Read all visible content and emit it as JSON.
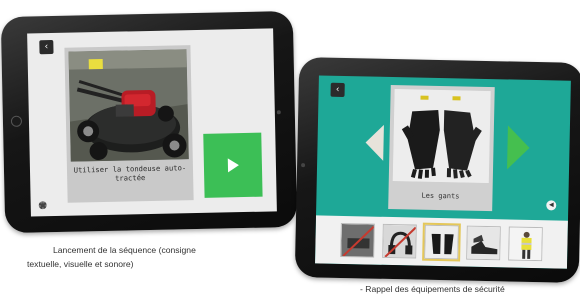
{
  "slide_left": {
    "back_icon": "chevron-left-icon",
    "card_caption": "Utiliser la tondeuse auto-tractée",
    "play_icon": "play-icon",
    "settings_icon": "gear-icon",
    "description_line1": "Lancement de la séquence (consigne",
    "description_line2": "textuelle, visuelle et sonore)"
  },
  "slide_right": {
    "back_icon": "chevron-left-icon",
    "card_caption": "Les gants",
    "prev_icon": "arrow-left-icon",
    "next_icon": "arrow-right-icon",
    "speaker_icon": "speaker-icon",
    "thumbnails": [
      {
        "name": "crossed-out-item-thumbnail",
        "active": false
      },
      {
        "name": "crossed-out-headphones-thumbnail",
        "active": false
      },
      {
        "name": "gloves-thumbnail",
        "active": true
      },
      {
        "name": "safety-shoes-thumbnail",
        "active": false
      },
      {
        "name": "safety-vest-thumbnail",
        "active": false
      }
    ],
    "description": "- Rappel des équipements de sécurité"
  },
  "colors": {
    "teal_screen": "#1ea897",
    "play_green": "#3cbf56",
    "next_arrow_green": "#45bf4f",
    "thumb_highlight": "#e4c75a"
  }
}
